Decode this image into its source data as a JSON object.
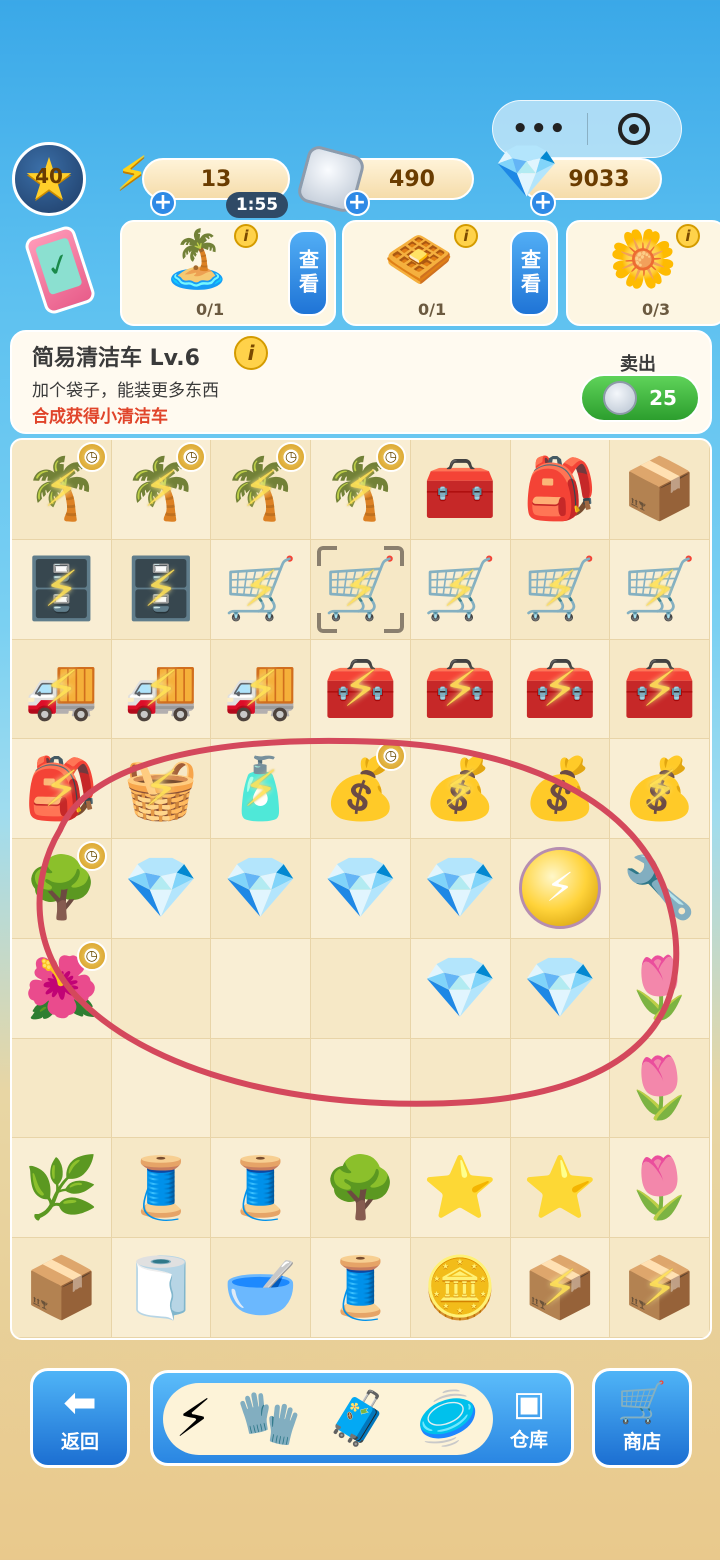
{
  "top": {
    "menu_dots": "•••"
  },
  "level": {
    "value": "40"
  },
  "resources": {
    "energy": {
      "value": "13",
      "timer": "1:55",
      "icon": "lightning-icon"
    },
    "coins": {
      "value": "490",
      "icon": "silver-coin-icon"
    },
    "gems": {
      "value": "9033",
      "icon": "blue-gem-icon"
    }
  },
  "orders": [
    {
      "icon": "island-plant",
      "glyph": "🏝️",
      "count": "0/1",
      "button": "查看"
    },
    {
      "icon": "biscuit",
      "glyph": "🧇",
      "count": "0/1",
      "button": "查看"
    },
    {
      "icon": "flower-planter",
      "glyph": "🌼",
      "count": "0/3"
    }
  ],
  "info": {
    "title": "简易清洁车 Lv.6",
    "description": "加个袋子，能装更多东西",
    "hint": "合成获得小清洁车",
    "sell_label": "卖出",
    "sell_price": "25"
  },
  "board": {
    "rows": [
      [
        "🌴",
        "🌴",
        "🌴",
        "🌴",
        "🧰",
        "🎒",
        "📦"
      ],
      [
        "🗄️",
        "🗄️",
        "🛒",
        "🛒",
        "🛒",
        "🛒",
        "🛒"
      ],
      [
        "🚚",
        "🚚",
        "🚚",
        "🧰",
        "🧰",
        "🧰",
        "🧰"
      ],
      [
        "🎒",
        "🧺",
        "🧴",
        "💰",
        "💰",
        "💰",
        "💰"
      ],
      [
        "🌳",
        "💎",
        "💎",
        "💎",
        "💎",
        "🟡",
        "🔧"
      ],
      [
        "🌺",
        "",
        "",
        "",
        "💎",
        "💎",
        "🌷"
      ],
      [
        "",
        "",
        "",
        "",
        "",
        "",
        "🌷"
      ],
      [
        "🌿",
        "🧵",
        "🧵",
        "🌳",
        "⭐",
        "⭐",
        "🌷"
      ],
      [
        "📦",
        "🧻",
        "🥣",
        "🧵",
        "🪙",
        "📦",
        "📦"
      ]
    ]
  },
  "bottom": {
    "back": "返回",
    "storage": "仓库",
    "shop": "商店",
    "tray": [
      "⚡",
      "🧤",
      "🧳",
      "🥏"
    ]
  }
}
